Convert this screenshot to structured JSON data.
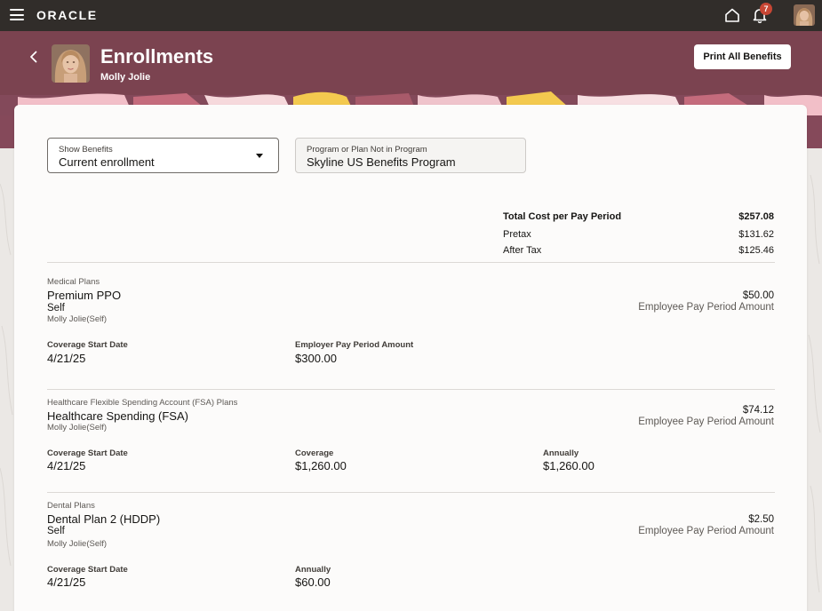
{
  "brand": {
    "logo_text": "ORACLE",
    "notification_count": "7"
  },
  "header": {
    "title": "Enrollments",
    "person_name": "Molly Jolie",
    "print_button_label": "Print All Benefits"
  },
  "filters": {
    "show_benefits_label": "Show Benefits",
    "show_benefits_value": "Current enrollment",
    "program_label": "Program or Plan Not in Program",
    "program_value": "Skyline US Benefits Program"
  },
  "totals": {
    "total_label": "Total Cost per Pay Period",
    "total_value": "$257.08",
    "pretax_label": "Pretax",
    "pretax_value": "$131.62",
    "aftertax_label": "After Tax",
    "aftertax_value": "$125.46"
  },
  "plans": [
    {
      "category": "Medical Plans",
      "name": "Premium PPO",
      "level": "Self",
      "covered": "Molly Jolie(Self)",
      "amount": "$50.00",
      "amount_label": "Employee Pay Period Amount",
      "details": [
        {
          "label": "Coverage Start Date",
          "value": "4/21/25"
        },
        {
          "label": "Employer Pay Period Amount",
          "value": "$300.00"
        }
      ]
    },
    {
      "category": "Healthcare Flexible Spending Account (FSA) Plans",
      "name": "Healthcare Spending (FSA)",
      "covered": "Molly Jolie(Self)",
      "amount": "$74.12",
      "amount_label": "Employee Pay Period Amount",
      "details": [
        {
          "label": "Coverage Start Date",
          "value": "4/21/25"
        },
        {
          "label": "Coverage",
          "value": "$1,260.00"
        },
        {
          "label": "Annually",
          "value": "$1,260.00"
        }
      ]
    },
    {
      "category": "Dental Plans",
      "name": "Dental Plan 2 (HDDP)",
      "level": "Self",
      "covered": "Molly Jolie(Self)",
      "amount": "$2.50",
      "amount_label": "Employee Pay Period Amount",
      "details": [
        {
          "label": "Coverage Start Date",
          "value": "4/21/25"
        },
        {
          "label": "Annually",
          "value": "$60.00"
        }
      ]
    }
  ],
  "colors": {
    "top_bar": "#312d2a",
    "banner": "#7b4350",
    "notification_badge": "#c74634",
    "card": "#fcfbfa"
  },
  "icons": [
    "hamburger-menu-icon",
    "home-icon",
    "notifications-bell-icon",
    "back-chevron-icon",
    "dropdown-caret-icon"
  ]
}
